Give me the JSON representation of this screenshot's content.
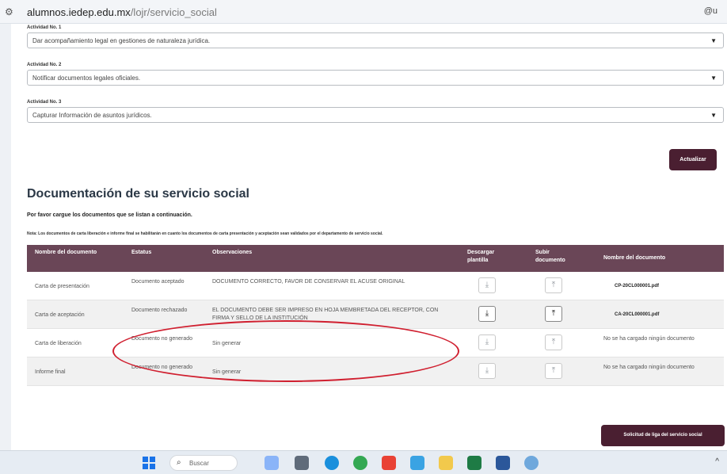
{
  "browser": {
    "url_host": "alumnos.iedep.edu.mx",
    "url_path": "/lojr/servicio_social",
    "right_text": "@u"
  },
  "activities": [
    {
      "label": "Actividad No. 1",
      "value": "Dar acompañamiento legal en gestiones de naturaleza jurídica."
    },
    {
      "label": "Actividad No. 2",
      "value": "Notificar documentos legales oficiales."
    },
    {
      "label": "Actividad No. 3",
      "value": "Capturar Información de asuntos jurídicos."
    }
  ],
  "buttons": {
    "actualizar": "Actualizar",
    "solicitud": "Solicitud de liga del servicio social"
  },
  "section": {
    "title": "Documentación de su servicio social",
    "instruction": "Por favor cargue los documentos que se listan a continuación.",
    "note": "Nota: Los documentos de carta liberación e informe final se habilitarán en cuanto los documentos de carta presentación y aceptación sean validados por el departamento de servicio social."
  },
  "table": {
    "headers": {
      "name": "Nombre del documento",
      "status": "Estatus",
      "observations": "Observaciones",
      "download": "Descargar plantilla",
      "upload": "Subir documento",
      "filename": "Nombre del documento"
    },
    "rows": [
      {
        "name": "Carta de presentación",
        "status": "Documento aceptado",
        "observations": "DOCUMENTO CORRECTO, FAVOR DE CONSERVAR EL ACUSE ORIGINAL",
        "filename": "CP-20CL000001.pdf",
        "active": false
      },
      {
        "name": "Carta de aceptación",
        "status": "Documento rechazado",
        "observations": "EL DOCUMENTO DEBE SER IMPRESO EN HOJA MEMBRETADA DEL RECEPTOR, CON FIRMA Y SELLO DE LA INSTITUCIÓN",
        "filename": "CA-20CL000001.pdf",
        "active": true
      },
      {
        "name": "Carta de liberación",
        "status": "Documento no generado",
        "observations": "Sin generar",
        "filename": "No se ha cargado ningún documento",
        "active": false
      },
      {
        "name": "Informe final",
        "status": "Documento no generado",
        "observations": "Sin generar",
        "filename": "No se ha cargado ningún documento",
        "active": false
      }
    ]
  },
  "taskbar": {
    "search_placeholder": "Buscar",
    "chevron": "^"
  },
  "colors": {
    "header_bg": "#6a4657",
    "button_bg": "#4a1f31",
    "annotation": "#d02030"
  },
  "icons": {
    "download": "download-icon",
    "upload": "upload-icon",
    "dropdown": "chevron-down-icon"
  }
}
